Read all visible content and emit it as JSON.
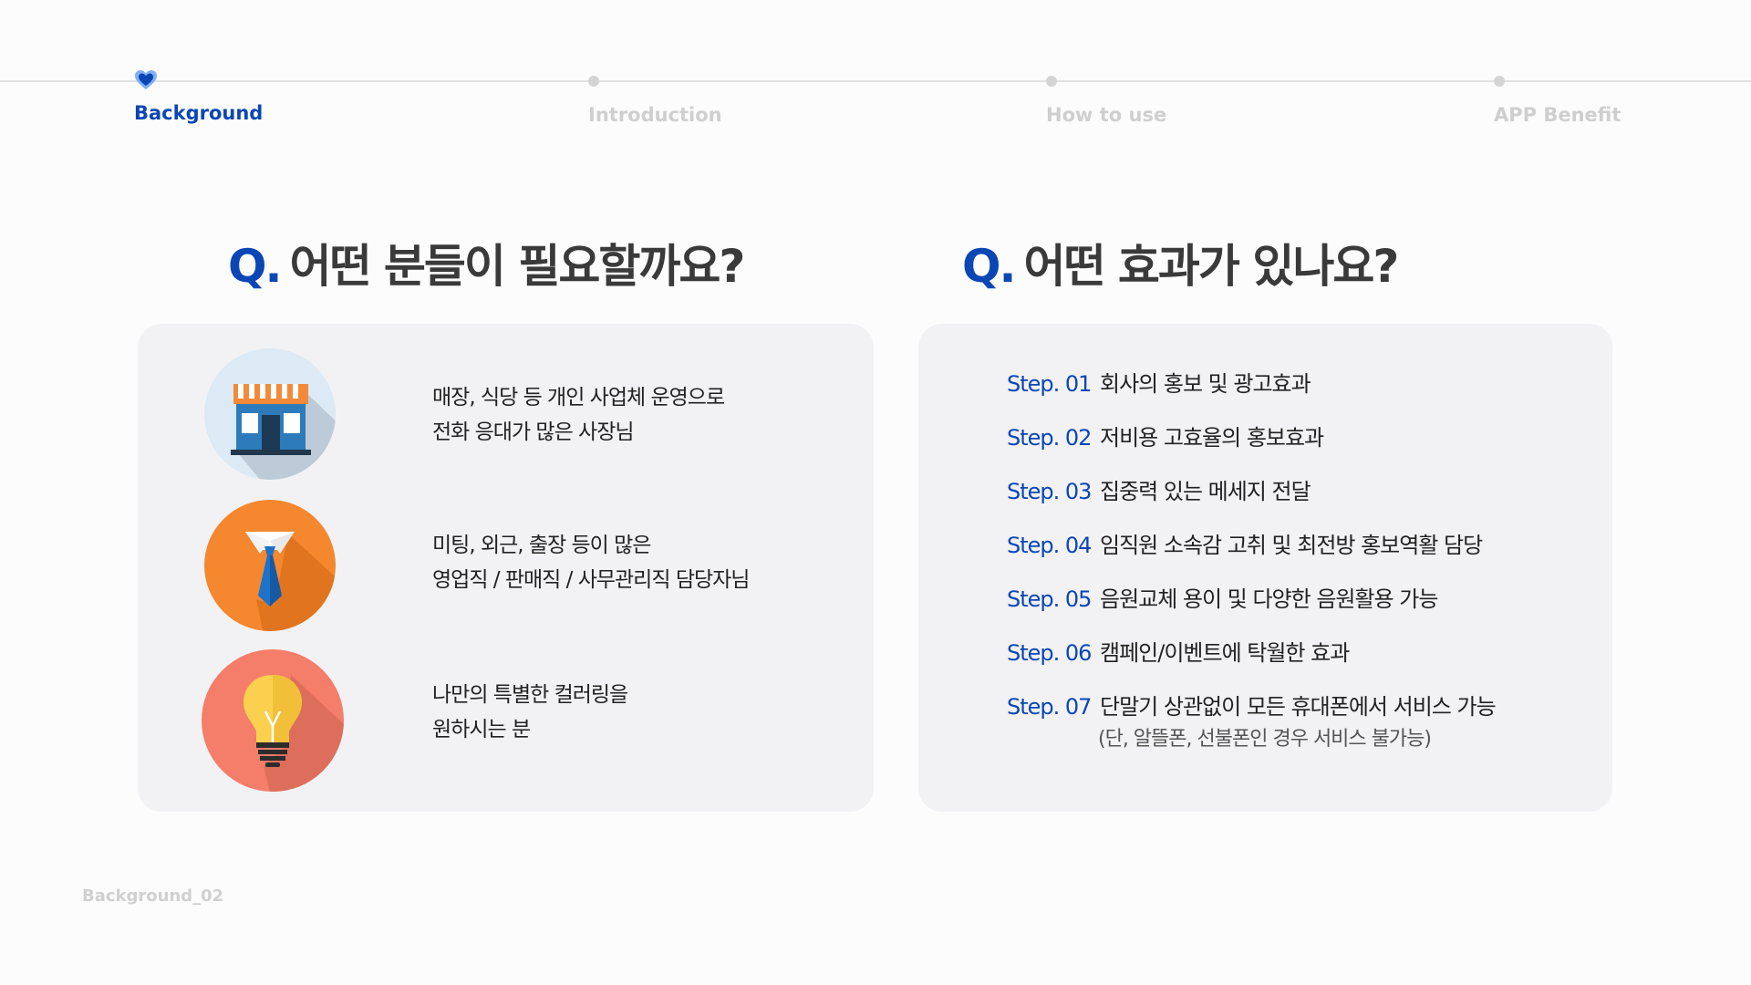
{
  "nav": {
    "steps": [
      {
        "label": "Background",
        "active": true
      },
      {
        "label": "Introduction",
        "active": false
      },
      {
        "label": "How to use",
        "active": false
      },
      {
        "label": "APP Benefit",
        "active": false
      }
    ]
  },
  "left": {
    "q": "Q.",
    "title": "어떤 분들이 필요할까요?",
    "items": [
      {
        "icon": "store-icon",
        "line1": "매장, 식당 등 개인 사업체 운영으로",
        "line2": "전화 응대가 많은 사장님"
      },
      {
        "icon": "necktie-icon",
        "line1": "미팅, 외근, 출장 등이 많은",
        "line2": "영업직 / 판매직 / 사무관리직 담당자님"
      },
      {
        "icon": "lightbulb-icon",
        "line1": "나만의 특별한 컬러링을",
        "line2": "원하시는 분"
      }
    ]
  },
  "right": {
    "q": "Q.",
    "title": "어떤 효과가 있나요?",
    "steps": [
      {
        "label": "Step. 01",
        "text": "회사의 홍보 및 광고효과"
      },
      {
        "label": "Step. 02",
        "text": "저비용 고효율의 홍보효과"
      },
      {
        "label": "Step. 03",
        "text": "집중력 있는 메세지 전달"
      },
      {
        "label": "Step. 04",
        "text": "임직원 소속감 고취 및 최전방 홍보역활 담당"
      },
      {
        "label": "Step. 05",
        "text": "음원교체 용이 및 다양한 음원활용 가능"
      },
      {
        "label": "Step. 06",
        "text": "캠페인/이벤트에 탁월한 효과"
      },
      {
        "label": "Step. 07",
        "text": "단말기 상관없이 모든 휴대폰에서 서비스 가능",
        "note": "(단, 알뜰폰, 선불폰인 경우 서비스 불가능)"
      }
    ]
  },
  "footer": "Background_02",
  "colors": {
    "accent": "#0b46b5",
    "panel": "#f2f2f4",
    "inactive": "#cfcfcf"
  }
}
